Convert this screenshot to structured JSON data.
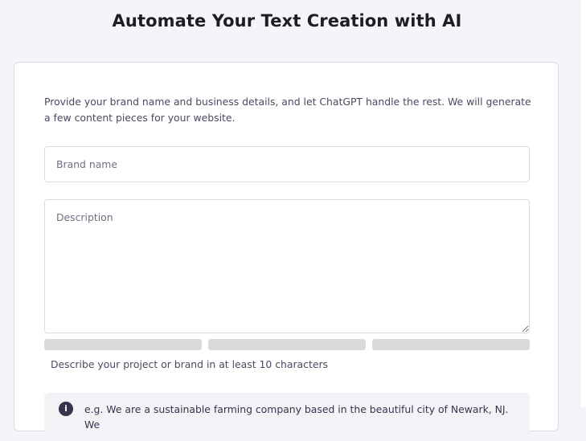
{
  "page": {
    "title": "Automate Your Text Creation with AI"
  },
  "form": {
    "intro": "Provide your brand name and business details, and let ChatGPT handle the rest. We will generate a few content pieces for your website.",
    "brand_name": {
      "value": "",
      "placeholder": "Brand name"
    },
    "description": {
      "value": "",
      "placeholder": "Description"
    },
    "strength_meter": {
      "segments": 3,
      "filled": 0
    },
    "helper_text": "Describe your project or brand in at least 10 characters",
    "example": {
      "icon": "info-icon",
      "icon_glyph": "i",
      "text": "e.g. We are a sustainable farming company based in the beautiful city of Newark, NJ. We"
    }
  },
  "colors": {
    "background": "#f4f4fb",
    "card": "#ffffff",
    "border": "#dadce0",
    "meter_empty": "#d9d9dc",
    "title": "#1d1e20"
  }
}
